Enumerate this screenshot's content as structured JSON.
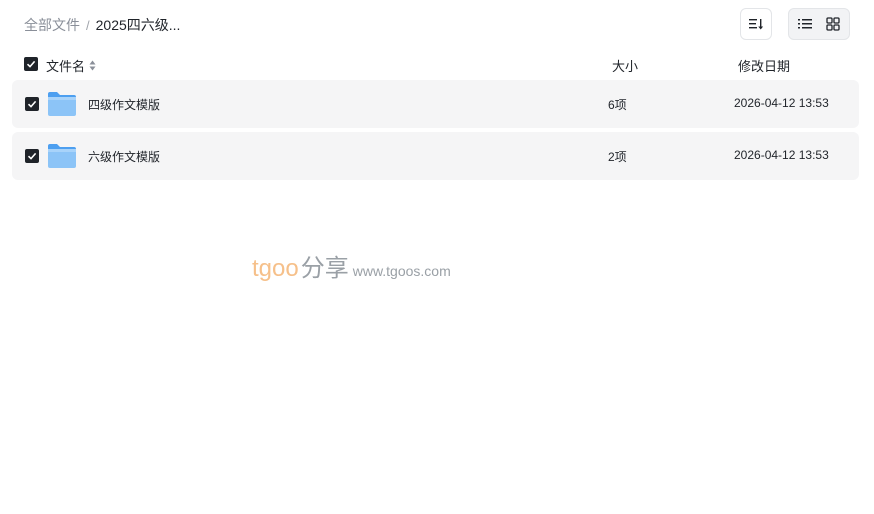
{
  "breadcrumb": {
    "root": "全部文件",
    "separator": "/",
    "current": "2025四六级..."
  },
  "toolbar": {
    "sort_icon": "sort-lines-icon",
    "view_list_icon": "list-view-icon",
    "view_grid_icon": "grid-view-icon",
    "active_view": "list"
  },
  "table": {
    "columns": {
      "name": "文件名",
      "size": "大小",
      "date": "修改日期"
    },
    "rows": [
      {
        "name": "四级作文模版",
        "size": "6项",
        "date": "2026-04-12 13:53",
        "type": "folder",
        "checked": true
      },
      {
        "name": "六级作文模版",
        "size": "2项",
        "date": "2026-04-12 13:53",
        "type": "folder",
        "checked": true
      }
    ]
  },
  "watermark": {
    "brand": "tgoo",
    "share": "分享",
    "url": "www.tgoos.com"
  },
  "colors": {
    "row_bg": "#f5f5f6",
    "checkbox": "#1f2329",
    "folder": "#6fb3f2",
    "watermark_brand": "#f6c08a"
  }
}
